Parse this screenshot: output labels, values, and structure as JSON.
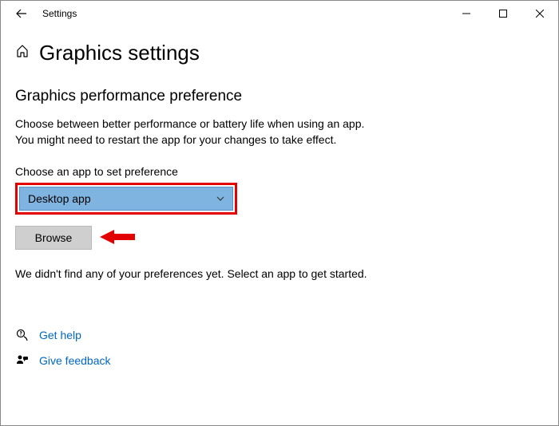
{
  "titlebar": {
    "title": "Settings"
  },
  "page": {
    "heading": "Graphics settings",
    "sub_heading": "Graphics performance preference",
    "description_line1": "Choose between better performance or battery life when using an app.",
    "description_line2": "You might need to restart the app for your changes to take effect.",
    "choose_label": "Choose an app to set preference",
    "dropdown_value": "Desktop app",
    "browse_label": "Browse",
    "empty_message": "We didn't find any of your preferences yet. Select an app to get started."
  },
  "links": {
    "help": "Get help",
    "feedback": "Give feedback"
  }
}
